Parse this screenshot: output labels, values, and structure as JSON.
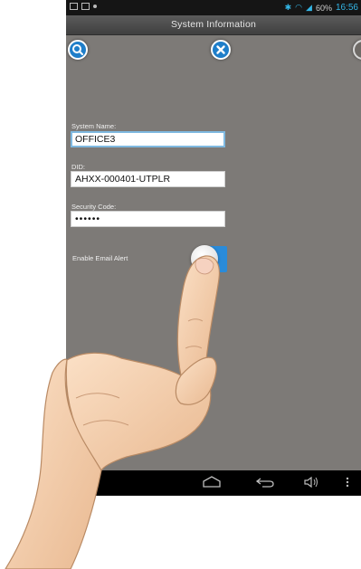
{
  "statusbar": {
    "time": "16:56",
    "battery": "60%"
  },
  "header": {
    "title": "System Information"
  },
  "form": {
    "system_name": {
      "label": "System Name:",
      "value": "OFFICE3"
    },
    "did": {
      "label": "DID:",
      "value": "AHXX-000401-UTPLR"
    },
    "security_code": {
      "label": "Security Code:",
      "value": "••••••"
    },
    "email_alert": {
      "label": "Enable Email Alert",
      "enabled": true
    }
  },
  "icons": {
    "search": "search-icon",
    "close": "close-icon",
    "partial_right": "partial-icon",
    "nav_home": "home-icon",
    "nav_back": "back-icon",
    "nav_volume": "volume-icon",
    "nav_menu": "menu-icon"
  },
  "colors": {
    "accent": "#2a8bd9",
    "background": "#7d7a77",
    "status_time": "#33b5e5"
  }
}
